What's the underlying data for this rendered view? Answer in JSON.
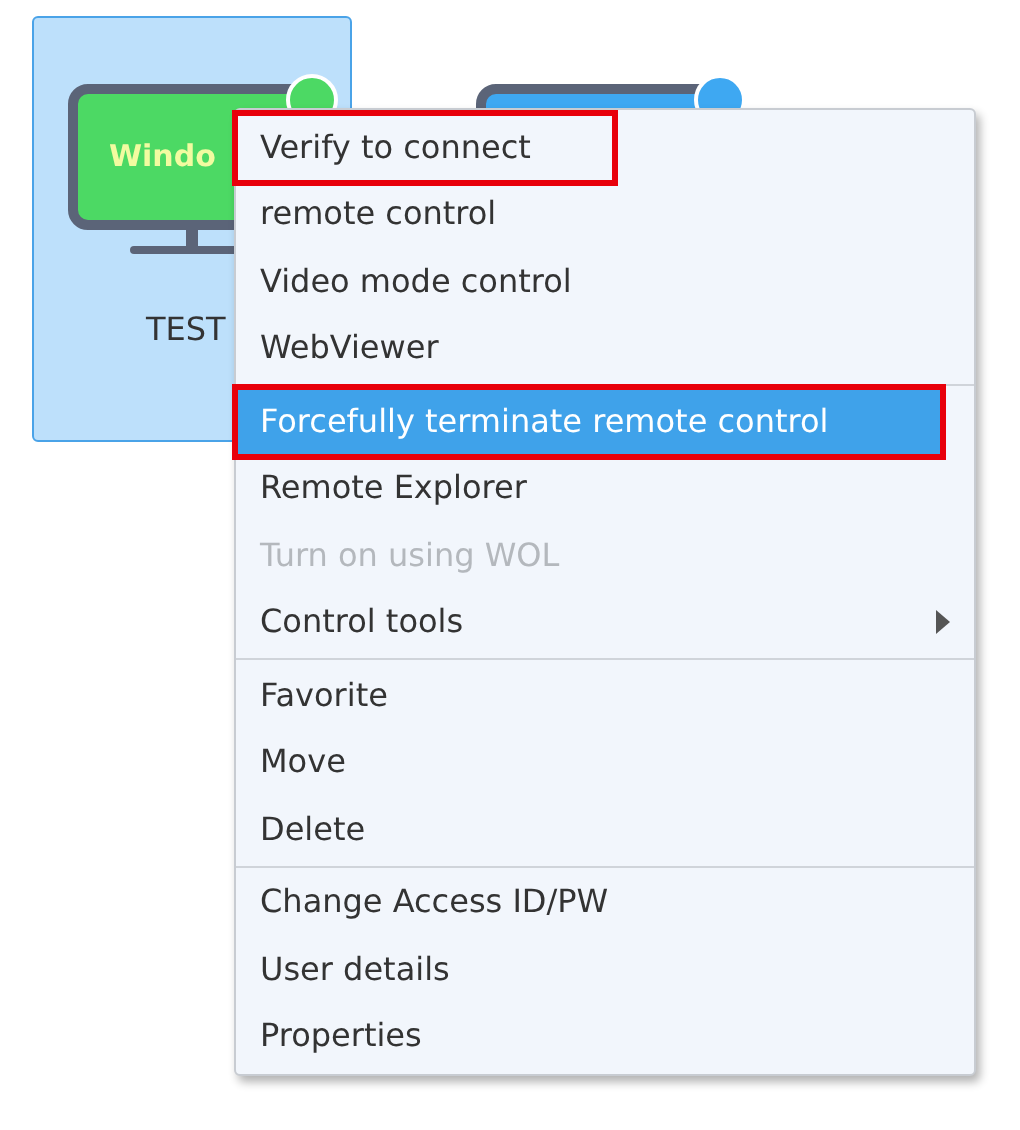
{
  "device_cards": [
    {
      "screen_text": "Windo",
      "name": "TEST",
      "selected": true,
      "color": "#4cd964"
    },
    {
      "selected": false,
      "color": "#3ea8f2"
    }
  ],
  "context_menu": {
    "sections": [
      [
        {
          "label": "Verify to connect",
          "selected": false,
          "disabled": false,
          "submenu": false,
          "outlined": true
        },
        {
          "label": "remote control",
          "selected": false,
          "disabled": false,
          "submenu": false,
          "outlined": false
        },
        {
          "label": "Video mode control",
          "selected": false,
          "disabled": false,
          "submenu": false,
          "outlined": false
        },
        {
          "label": "WebViewer",
          "selected": false,
          "disabled": false,
          "submenu": false,
          "outlined": false
        }
      ],
      [
        {
          "label": "Forcefully terminate remote control",
          "selected": true,
          "disabled": false,
          "submenu": false,
          "outlined": true
        },
        {
          "label": "Remote Explorer",
          "selected": false,
          "disabled": false,
          "submenu": false,
          "outlined": false
        },
        {
          "label": "Turn on using WOL",
          "selected": false,
          "disabled": true,
          "submenu": false,
          "outlined": false
        },
        {
          "label": "Control tools",
          "selected": false,
          "disabled": false,
          "submenu": true,
          "outlined": false
        }
      ],
      [
        {
          "label": "Favorite",
          "selected": false,
          "disabled": false,
          "submenu": false,
          "outlined": false
        },
        {
          "label": "Move",
          "selected": false,
          "disabled": false,
          "submenu": false,
          "outlined": false
        },
        {
          "label": "Delete",
          "selected": false,
          "disabled": false,
          "submenu": false,
          "outlined": false
        }
      ],
      [
        {
          "label": "Change Access ID/PW",
          "selected": false,
          "disabled": false,
          "submenu": false,
          "outlined": false
        },
        {
          "label": "User details",
          "selected": false,
          "disabled": false,
          "submenu": false,
          "outlined": false
        },
        {
          "label": "Properties",
          "selected": false,
          "disabled": false,
          "submenu": false,
          "outlined": false
        }
      ]
    ]
  }
}
